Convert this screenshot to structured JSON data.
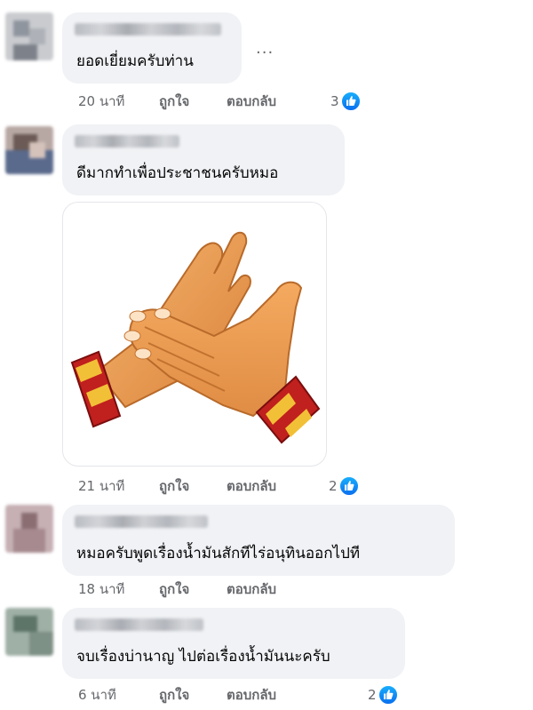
{
  "comments": [
    {
      "text": "ยอดเยี่ยมครับท่าน",
      "time": "20 นาที",
      "like_label": "ถูกใจ",
      "reply_label": "ตอบกลับ",
      "reaction_count": "3",
      "more_label": "..."
    },
    {
      "text": "ดีมากทำเพื่อประชาชนครับหมอ",
      "time": "21 นาที",
      "like_label": "ถูกใจ",
      "reply_label": "ตอบกลับ",
      "reaction_count": "2",
      "sticker": "clapping-hands-sticker"
    },
    {
      "text": "หมอครับพูดเรื่องน้ำมันสักทีไร่อนุทินออกไปที",
      "time": "18 นาที",
      "like_label": "ถูกใจ",
      "reply_label": "ตอบกลับ"
    },
    {
      "text": "จบเรื่องบ่านาญ ไปต่อเรื่องน้ำมันนะครับ",
      "time": "6 นาที",
      "like_label": "ถูกใจ",
      "reply_label": "ตอบกลับ",
      "reaction_count": "2"
    }
  ],
  "colors": {
    "bubble": "#f0f2f5",
    "secondary_text": "#65676b",
    "like_blue": "#1877f2"
  },
  "icons": {
    "reaction": "like-thumb-icon",
    "sticker": "clapping-hands-sticker"
  }
}
